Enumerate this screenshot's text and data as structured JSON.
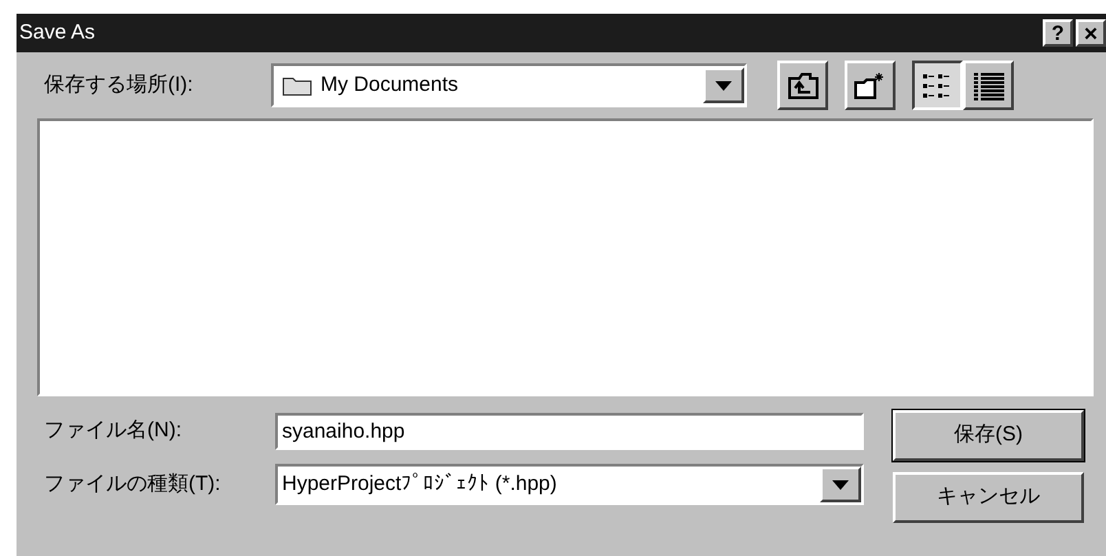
{
  "window": {
    "title": "Save As",
    "help_button": "?",
    "close_button": "×"
  },
  "location": {
    "label": "保存する場所(I):",
    "value": "My Documents"
  },
  "toolbar": [
    {
      "kind": "up"
    },
    {
      "kind": "newfolder"
    },
    {
      "kind": "list",
      "selected": true
    },
    {
      "kind": "details",
      "selected": false
    }
  ],
  "file_name": {
    "label": "ファイル名(N):",
    "value": "syanaiho.hpp"
  },
  "file_type": {
    "label": "ファイルの種類(T):",
    "value": "HyperProjectﾌﾟﾛｼﾞｪｸﾄ (*.hpp)"
  },
  "buttons": [
    {
      "label": "保存(S)",
      "default": true
    },
    {
      "label": "キャンセル",
      "default": false
    }
  ]
}
